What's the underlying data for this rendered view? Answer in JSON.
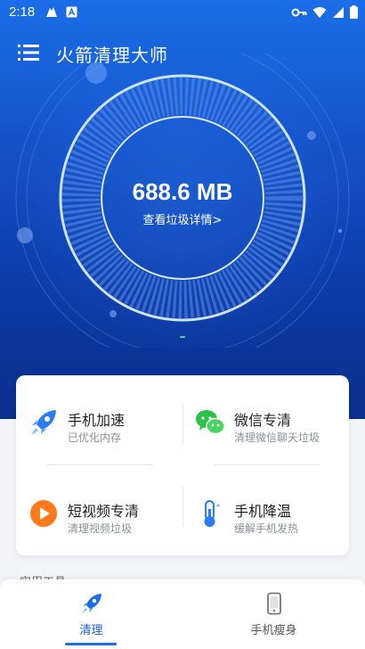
{
  "status_bar": {
    "time": "2:18",
    "icons": [
      "cleaner-notify-icon",
      "a-icon",
      "vpn-key-icon",
      "wifi-icon",
      "signal-icon",
      "battery-icon"
    ]
  },
  "header": {
    "title": "火箭清理大师",
    "menu_icon": "menu-icon"
  },
  "scan": {
    "size": "688.6 MB",
    "detail_link": "查看垃圾详情>"
  },
  "tools": [
    {
      "name": "手机加速",
      "desc": "已优化内存",
      "icon": "rocket-icon"
    },
    {
      "name": "微信专清",
      "desc": "清理微信聊天垃圾",
      "icon": "wechat-icon"
    },
    {
      "name": "短视频专清",
      "desc": "清理视频垃圾",
      "icon": "play-icon"
    },
    {
      "name": "手机降温",
      "desc": "缓解手机发热",
      "icon": "thermometer-icon"
    }
  ],
  "section_label": "实用工具",
  "tabs": [
    {
      "label": "清理",
      "icon": "rocket-tab-icon",
      "active": true
    },
    {
      "label": "手机瘦身",
      "icon": "phone-icon",
      "active": false
    }
  ],
  "colors": {
    "hero_top": "#1a6ee8",
    "hero_bottom": "#0a2f8e",
    "accent": "#1a5bd6"
  }
}
